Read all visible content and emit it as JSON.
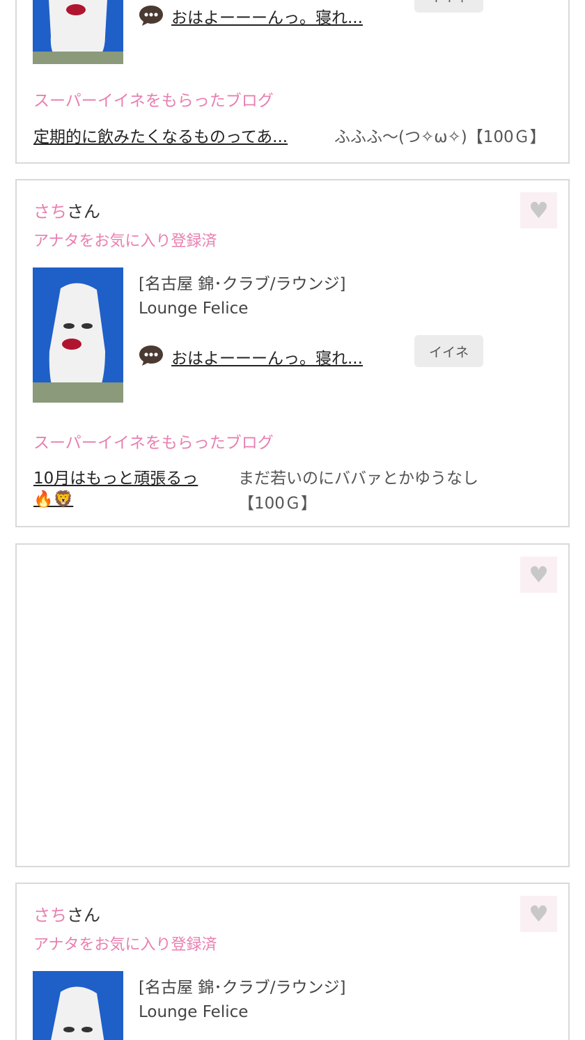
{
  "cards": [
    {
      "comment_text": "おはよーーーんっ。寝れ...",
      "like_label": "イイネ",
      "super_like_heading": "スーパーイイネをもらったブログ",
      "blog_title": "定期的に飲みたくなるものってあ...",
      "blog_comment": "ふふふ〜(つ✧ω✧)【100Ｇ】"
    },
    {
      "user_name": "さち",
      "user_suffix": "さん",
      "favorite_status": "アナタをお気に入り登録済",
      "shop_category": "[名古屋 錦･クラブ/ラウンジ]",
      "shop_name": "Lounge Felice",
      "comment_text": "おはよーーーんっ。寝れ...",
      "like_label": "イイネ",
      "super_like_heading": "スーパーイイネをもらったブログ",
      "blog_title_line1": "10月はもっと頑張るっ",
      "blog_title_line2": "🔥🦁",
      "blog_comment_line1": "まだ若いのにババァとかゆうなし",
      "blog_comment_line2": "【100Ｇ】"
    },
    {},
    {
      "user_name": "さち",
      "user_suffix": "さん",
      "favorite_status": "アナタをお気に入り登録済",
      "shop_category": "[名古屋 錦･クラブ/ラウンジ]",
      "shop_name": "Lounge Felice"
    }
  ],
  "icons": {
    "favorite": "heart-icon",
    "comment": "speech-bubble-icon"
  },
  "colors": {
    "accent_pink": "#e87fb0",
    "favorite_bg": "#faf0f3",
    "heart_gray": "#c8c8c8",
    "like_button_bg": "#ececec",
    "card_border": "#d9d9d9"
  }
}
